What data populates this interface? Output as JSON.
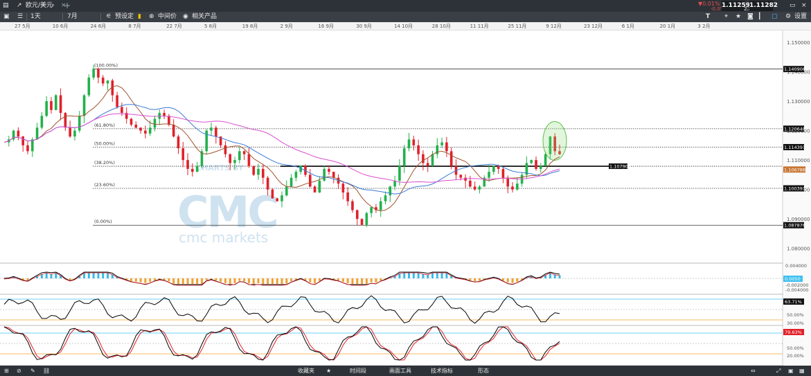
{
  "topbar": {
    "instrument": "欧元/美元",
    "change_pct": "▼0.01%",
    "change_abs": "-0.0°",
    "sell_price": "1.11259",
    "buy_price": "1.11282",
    "spread": "2.3"
  },
  "toolbar": {
    "interval": "1天",
    "range": "7月",
    "preset": "预设定",
    "mid_price": "中间价",
    "related": "相关产品",
    "settings": "设置",
    "tool_t": "T"
  },
  "date_axis": [
    "27 5月",
    "10 6月",
    "24 6月",
    "8 7月",
    "22 7月",
    "5 8月",
    "19 8月",
    "2 9月",
    "16 9月",
    "30 9月",
    "14 10月",
    "28 10月",
    "11 11月",
    "25 11月",
    "9 12月",
    "23 12月",
    "6 1月",
    "20 1月",
    "3 2月"
  ],
  "main_axis": [
    "1.150000",
    "1.140000",
    "1.130000",
    "1.120000",
    "1.110000",
    "1.100000",
    "1.090000",
    "1.080000"
  ],
  "fib_levels": [
    {
      "label": "(100.00%)",
      "price": 1.140906,
      "tag": "1.140906"
    },
    {
      "label": "(61.80%)",
      "price": 1.120648,
      "tag": "1.120648"
    },
    {
      "label": "(50.00%)",
      "price": 1.114391,
      "tag": "1.114391"
    },
    {
      "label": "(38.20%)",
      "price": 1.107906,
      "tag": "1.107906"
    },
    {
      "label": "(23.60%)",
      "price": 1.100391,
      "tag": "1.100391"
    },
    {
      "label": "(0.00%)",
      "price": 1.087876,
      "tag": "1.087876"
    }
  ],
  "current_price_tag": "1.106788",
  "watermark": {
    "charts_by": "CHARTS BY",
    "brand": "cmc markets"
  },
  "macd": {
    "axis": [
      "0.004000",
      "0.0000",
      "-0.002000",
      "-0.004000"
    ],
    "value": "0.0050"
  },
  "rsi": {
    "axis": [
      "50.00%",
      "30.00%"
    ],
    "value": "63.71%"
  },
  "stoch": {
    "axis": [
      "50.00%",
      "20.00%"
    ],
    "value": "79.63%"
  },
  "bottombar": {
    "favorites": "收藏夹",
    "timeframe": "时间段",
    "drawing": "画面工具",
    "indicators": "技术指标",
    "patterns": "形态"
  },
  "colors": {
    "up": "#22b14c",
    "down": "#e0202a",
    "ma_fast": "#a0522d",
    "ma_mid": "#3a7bd5",
    "ma_slow": "#d94fd0",
    "stoch_k": "#e0202a"
  },
  "chart_data": {
    "type": "candlestick",
    "instrument": "欧元/美元",
    "interval": "1天",
    "y_range": [
      1.075,
      1.154
    ],
    "last_price": 1.106788,
    "fib_retracement": {
      "high": 1.140906,
      "low": 1.087876
    },
    "horizontal_line": 1.107906,
    "price_path": [
      1.116,
      1.117,
      1.12,
      1.118,
      1.115,
      1.113,
      1.117,
      1.121,
      1.125,
      1.13,
      1.127,
      1.132,
      1.126,
      1.121,
      1.118,
      1.12,
      1.125,
      1.132,
      1.138,
      1.141,
      1.138,
      1.136,
      1.137,
      1.132,
      1.128,
      1.126,
      1.124,
      1.122,
      1.121,
      1.12,
      1.119,
      1.121,
      1.124,
      1.126,
      1.125,
      1.122,
      1.118,
      1.114,
      1.11,
      1.107,
      1.106,
      1.108,
      1.113,
      1.12,
      1.121,
      1.118,
      1.115,
      1.112,
      1.109,
      1.11,
      1.113,
      1.112,
      1.108,
      1.105,
      1.107,
      1.104,
      1.1,
      1.097,
      1.096,
      1.098,
      1.101,
      1.104,
      1.106,
      1.108,
      1.105,
      1.101,
      1.099,
      1.103,
      1.107,
      1.106,
      1.104,
      1.102,
      1.099,
      1.096,
      1.093,
      1.09,
      1.088,
      1.092,
      1.094,
      1.093,
      1.096,
      1.098,
      1.101,
      1.103,
      1.108,
      1.114,
      1.117,
      1.115,
      1.112,
      1.109,
      1.108,
      1.112,
      1.115,
      1.116,
      1.113,
      1.108,
      1.105,
      1.104,
      1.103,
      1.101,
      1.1,
      1.101,
      1.104,
      1.106,
      1.108,
      1.107,
      1.104,
      1.101,
      1.1,
      1.102,
      1.105,
      1.109,
      1.11,
      1.107,
      1.108,
      1.112,
      1.118,
      1.113,
      1.112
    ]
  }
}
